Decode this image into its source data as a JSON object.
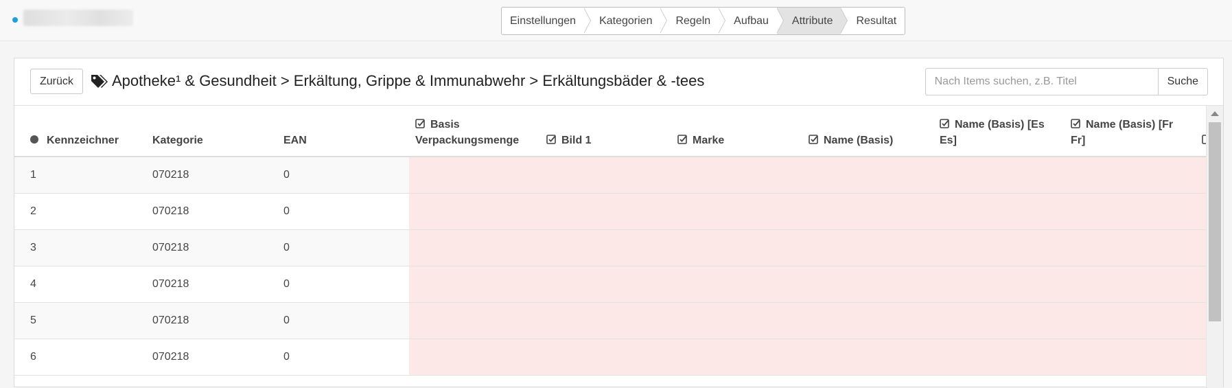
{
  "wizard": {
    "steps": [
      {
        "label": "Einstellungen"
      },
      {
        "label": "Kategorien"
      },
      {
        "label": "Regeln"
      },
      {
        "label": "Aufbau"
      },
      {
        "label": "Attribute"
      },
      {
        "label": "Resultat"
      }
    ],
    "active_step": "Attribute"
  },
  "panel": {
    "back_label": "Zurück",
    "title": "Apotheke¹ & Gesundheit > Erkältung, Grippe & Immunabwehr > Erkältungsbäder & -tees",
    "title_icon": "tags-icon",
    "search_placeholder": "Nach Items suchen, z.B. Titel",
    "search_button": "Suche"
  },
  "table": {
    "columns": [
      {
        "label": "Kennzeichner",
        "icon": "circle-icon"
      },
      {
        "label": "Kategorie"
      },
      {
        "label": "EAN"
      },
      {
        "label_line1": "Basis",
        "label_line2": "Verpackungsmenge",
        "icon": "checkbox-icon"
      },
      {
        "label": "Bild 1",
        "icon": "checkbox-icon"
      },
      {
        "label": "Marke",
        "icon": "checkbox-icon"
      },
      {
        "label": "Name (Basis)",
        "icon": "checkbox-icon"
      },
      {
        "label_line1": "Name (Basis) [Es",
        "label_line2": "Es]",
        "icon": "checkbox-icon"
      },
      {
        "label_line1": "Name (Basis) [Fr",
        "label_line2": "Fr]",
        "icon": "checkbox-icon"
      }
    ],
    "rows": [
      {
        "kennzeichner": "1",
        "kategorie": "070218",
        "ean": "0"
      },
      {
        "kennzeichner": "2",
        "kategorie": "070218",
        "ean": "0"
      },
      {
        "kennzeichner": "3",
        "kategorie": "070218",
        "ean": "0"
      },
      {
        "kennzeichner": "4",
        "kategorie": "070218",
        "ean": "0"
      },
      {
        "kennzeichner": "5",
        "kategorie": "070218",
        "ean": "0"
      },
      {
        "kennzeichner": "6",
        "kategorie": "070218",
        "ean": "0"
      }
    ],
    "missing_attribute_color": "#fde8e8"
  },
  "colors": {
    "status_dot": "#1ea0d8",
    "active_step_bg": "#e3e3e3"
  }
}
